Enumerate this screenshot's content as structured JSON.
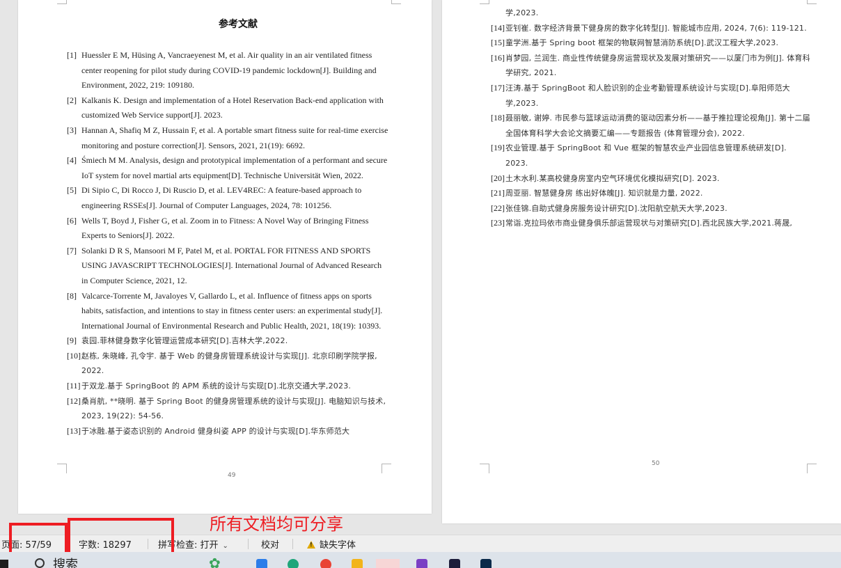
{
  "document": {
    "left_page": {
      "title": "参考文献",
      "page_number": "49",
      "references": [
        {
          "num": "[1]",
          "text": "Huessler E M, Hüsing A, Vancraeyenest M, et al. Air quality in an air ventilated fitness center reopening for pilot study during COVID-19 pandemic lockdown[J]. Building and Environment, 2022, 219: 109180."
        },
        {
          "num": "[2]",
          "text": "Kalkanis K. Design and implementation of a Hotel Reservation Back-end application with customized Web Service support[J]. 2023."
        },
        {
          "num": "[3]",
          "text": "Hannan A, Shafiq M Z, Hussain F, et al. A portable smart fitness suite for real-time exercise monitoring and posture correction[J]. Sensors, 2021, 21(19): 6692."
        },
        {
          "num": "[4]",
          "text": "Śmiech M M. Analysis, design and prototypical implementation of a performant and secure IoT system for novel martial arts equipment[D]. Technische Universität Wien, 2022."
        },
        {
          "num": "[5]",
          "text": "Di Sipio C, Di Rocco J, Di Ruscio D, et al. LEV4REC: A feature-based approach to engineering RSSEs[J]. Journal of Computer Languages, 2024, 78: 101256."
        },
        {
          "num": "[6]",
          "text": "Wells T, Boyd J, Fisher G, et al. Zoom in to Fitness: A Novel Way of Bringing Fitness Experts to Seniors[J]. 2022."
        },
        {
          "num": "[7]",
          "text": "Solanki D R S, Mansoori M F, Patel M, et al. PORTAL FOR FITNESS AND SPORTS USING JAVASCRIPT TECHNOLOGIES[J]. International Journal of Advanced Research in Computer Science, 2021, 12."
        },
        {
          "num": "[8]",
          "text": "Valcarce-Torrente M, Javaloyes V, Gallardo L, et al. Influence of fitness apps on sports habits, satisfaction, and intentions to stay in fitness center users: an experimental study[J]. International Journal of Environmental Research and Public Health, 2021, 18(19): 10393."
        },
        {
          "num": "[9]",
          "text": "袁园.菲林健身数字化管理运营成本研究[D].吉林大学,2022.",
          "cjk": true
        },
        {
          "num": "[10]",
          "text": "赵栋, 朱晓峰, 孔令宇. 基于 Web 的健身房管理系统设计与实现[J]. 北京印刷学院学报, 2022.",
          "cjk": true
        },
        {
          "num": "[11]",
          "text": "于双龙.基于 SpringBoot 的 APM 系统的设计与实现[D].北京交通大学,2023.",
          "cjk": true
        },
        {
          "num": "[12]",
          "text": "桑肖航, **晓明. 基于 Spring Boot 的健身房管理系统的设计与实现[J]. 电脑知识与技术, 2023, 19(22): 54-56.",
          "cjk": true
        },
        {
          "num": "[13]",
          "text": "于冰融.基于姿态识别的 Android 健身纠姿 APP 的设计与实现[D].华东师范大",
          "cjk": true
        }
      ]
    },
    "right_page": {
      "page_number": "50",
      "references": [
        {
          "num": "",
          "text": "学,2023.",
          "cjk": true
        },
        {
          "num": "[14]",
          "text": "亚钊崔. 数字经济背景下健身房的数字化转型[J]. 智能城市应用, 2024, 7(6): 119-121.",
          "cjk": true
        },
        {
          "num": "[15]",
          "text": "童学洲.基于 Spring boot 框架的物联网智慧消防系统[D].武汉工程大学,2023.",
          "cjk": true
        },
        {
          "num": "[16]",
          "text": "肖梦园, 兰润生. 商业性传统健身房运营现状及发展对策研究——以厦门市为例[J]. 体育科学研究, 2021.",
          "cjk": true
        },
        {
          "num": "[17]",
          "text": "汪涛.基于 SpringBoot 和人脸识别的企业考勤管理系统设计与实现[D].阜阳师范大学,2023.",
          "cjk": true
        },
        {
          "num": "[18]",
          "text": "聂丽敏, 谢婷. 市民参与篮球运动消费的驱动因素分析——基于推拉理论视角[J]. 第十二届全国体育科学大会论文摘要汇编——专题报告 (体育管理分会), 2022.",
          "cjk": true
        },
        {
          "num": "[19]",
          "text": "农业管理.基于 SpringBoot 和 Vue 框架的智慧农业产业园信息管理系统研发[D]. 2023.",
          "cjk": true
        },
        {
          "num": "[20]",
          "text": "土木水利.某高校健身房室内空气环境优化模拟研究[D]. 2023.",
          "cjk": true
        },
        {
          "num": "[21]",
          "text": "周亚丽. 智慧健身房 练出好体魄[J]. 知识就是力量, 2022.",
          "cjk": true
        },
        {
          "num": "[22]",
          "text": "张佳锦.自助式健身房服务设计研究[D].沈阳航空航天大学,2023.",
          "cjk": true
        },
        {
          "num": "[23]",
          "text": "常诣.克拉玛依市商业健身俱乐部运营现状与对策研究[D].西北民族大学,2021.蒋晟,",
          "cjk": true
        }
      ]
    }
  },
  "statusbar": {
    "page": "页面: 57/59",
    "word_count": "字数: 18297",
    "spell_check": "拼写检查: 打开",
    "proofread": "校对",
    "missing_font": "缺失字体"
  },
  "annotation": {
    "text": "所有文档均可分享",
    "color": "#ee1d23"
  },
  "taskbar": {
    "search": "搜索"
  }
}
